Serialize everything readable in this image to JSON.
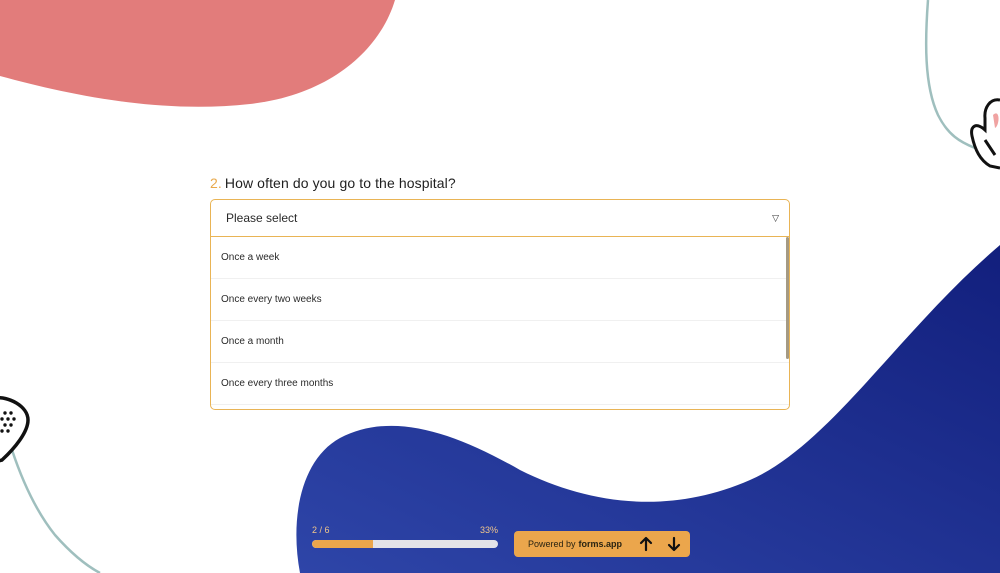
{
  "question": {
    "number": "2.",
    "text": "How often do you go to the hospital?"
  },
  "select": {
    "placeholder": "Please select",
    "options": [
      "Once a week",
      "Once every two weeks",
      "Once a month",
      "Once every three months"
    ]
  },
  "progress": {
    "step": "2 / 6",
    "percent_label": "33%",
    "value": 0.33
  },
  "footer": {
    "powered_by": "Powered by",
    "brand": "forms.app"
  },
  "icons": [
    "caret-down-icon",
    "arrow-up-icon",
    "arrow-down-icon",
    "bandage-icon",
    "hand-icon"
  ],
  "colors": {
    "accent": "#eba64c",
    "coral": "#e27c7b",
    "navy": "#1a2a8c",
    "teal_line": "#9fbfbe"
  }
}
